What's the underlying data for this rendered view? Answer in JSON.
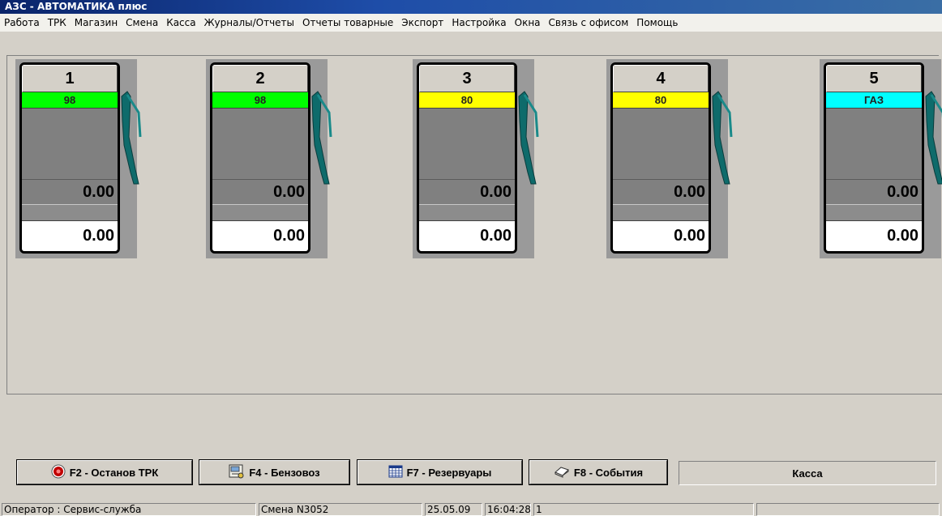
{
  "window": {
    "title": "АЗС - АВТОМАТИКА плюс"
  },
  "menu": [
    "Работа",
    "ТРК",
    "Магазин",
    "Смена",
    "Касса",
    "Журналы/Отчеты",
    "Отчеты товарные",
    "Экспорт",
    "Настройка",
    "Окна",
    "Связь с офисом",
    "Помощь"
  ],
  "pumps": [
    {
      "number": "1",
      "fuel": "98",
      "fuel_color": "#00ff00",
      "volume": "0.00",
      "amount": "0.00"
    },
    {
      "number": "2",
      "fuel": "98",
      "fuel_color": "#00ff00",
      "volume": "0.00",
      "amount": "0.00"
    },
    {
      "number": "3",
      "fuel": "80",
      "fuel_color": "#ffff00",
      "volume": "0.00",
      "amount": "0.00"
    },
    {
      "number": "4",
      "fuel": "80",
      "fuel_color": "#ffff00",
      "volume": "0.00",
      "amount": "0.00"
    },
    {
      "number": "5",
      "fuel": "ГАЗ",
      "fuel_color": "#00ffff",
      "volume": "0.00",
      "amount": "0.00"
    }
  ],
  "buttons": {
    "stop_trk": "F2 - Останов ТРК",
    "fuel_truck": "F4 - Бензовоз",
    "tanks": "F7 - Резервуары",
    "events": "F8 - События",
    "kassa": "Касса"
  },
  "icons": {
    "stop_trk": "stop-record-icon",
    "fuel_truck": "tanker-truck-icon",
    "tanks": "calendar-grid-icon",
    "events": "book-icon",
    "pump": "fuel-nozzle-icon"
  },
  "status": {
    "operator": "Оператор : Сервис-служба",
    "shift": "Смена N3052",
    "date": "25.05.09",
    "time": "16:04:28",
    "num": "1",
    "extra": ""
  }
}
